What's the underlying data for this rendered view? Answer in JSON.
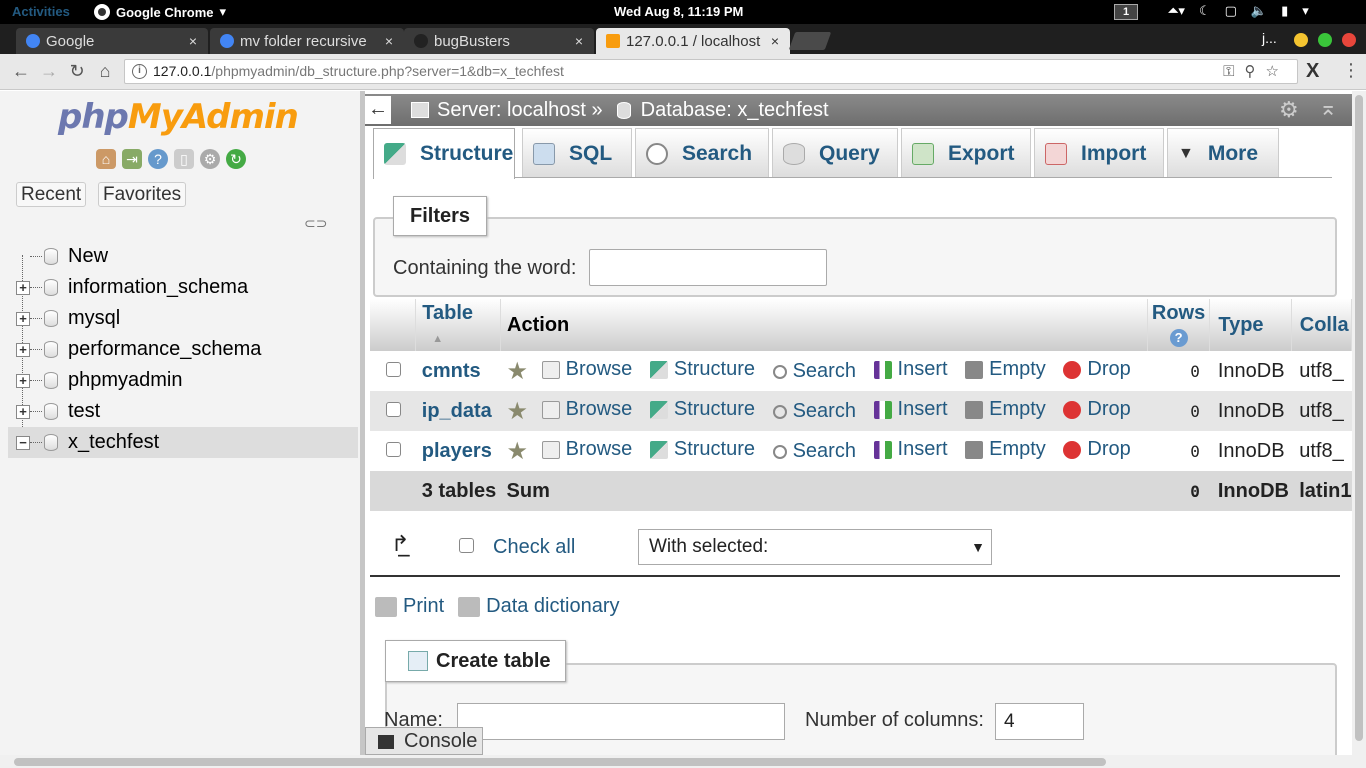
{
  "os": {
    "activities": "Activities",
    "app_name": "Google Chrome",
    "clock": "Wed Aug  8, 11:19 PM",
    "workspace": "1"
  },
  "browser": {
    "tabs": [
      {
        "title": "Google",
        "favicon_color": "#4285f4"
      },
      {
        "title": "mv folder recursive",
        "favicon_color": "#4285f4"
      },
      {
        "title": "bugBusters",
        "favicon_color": "#222222"
      },
      {
        "title": "127.0.0.1 / localhost",
        "favicon_color": "#f89c0e"
      }
    ],
    "profile": "j...",
    "url_host": "127.0.0.1",
    "url_path": "/phpmyadmin/db_structure.php?server=1&db=x_techfest"
  },
  "nav": {
    "recent": "Recent",
    "favorites": "Favorites",
    "tree": [
      {
        "label": "New",
        "expander": ""
      },
      {
        "label": "information_schema",
        "expander": "+"
      },
      {
        "label": "mysql",
        "expander": "+"
      },
      {
        "label": "performance_schema",
        "expander": "+"
      },
      {
        "label": "phpmyadmin",
        "expander": "+"
      },
      {
        "label": "test",
        "expander": "+"
      },
      {
        "label": "x_techfest",
        "expander": "−"
      }
    ]
  },
  "breadcrumb": {
    "server": "Server: localhost »",
    "database": "Database: x_techfest"
  },
  "tabs": [
    {
      "label": "Structure"
    },
    {
      "label": "SQL"
    },
    {
      "label": "Search"
    },
    {
      "label": "Query"
    },
    {
      "label": "Export"
    },
    {
      "label": "Import"
    },
    {
      "label": "More"
    }
  ],
  "filters": {
    "legend": "Filters",
    "label": "Containing the word:",
    "value": ""
  },
  "table": {
    "headers": {
      "table": "Table",
      "action": "Action",
      "rows": "Rows",
      "type": "Type",
      "collation": "Colla"
    },
    "actions": [
      "Browse",
      "Structure",
      "Search",
      "Insert",
      "Empty",
      "Drop"
    ],
    "rows": [
      {
        "name": "cmnts",
        "rows": "0",
        "type": "InnoDB",
        "collation": "utf8_"
      },
      {
        "name": "ip_data",
        "rows": "0",
        "type": "InnoDB",
        "collation": "utf8_"
      },
      {
        "name": "players",
        "rows": "0",
        "type": "InnoDB",
        "collation": "utf8_"
      }
    ],
    "summary": {
      "name": "3 tables",
      "label": "Sum",
      "rows": "0",
      "type": "InnoDB",
      "collation": "latin1"
    }
  },
  "bulk": {
    "check_all": "Check all",
    "with_selected": "With selected:"
  },
  "links": {
    "print": "Print",
    "data_dictionary": "Data dictionary"
  },
  "create": {
    "legend": "Create table",
    "name_label": "Name:",
    "name_value": "",
    "columns_label": "Number of columns:",
    "columns_value": "4"
  },
  "console": "Console"
}
